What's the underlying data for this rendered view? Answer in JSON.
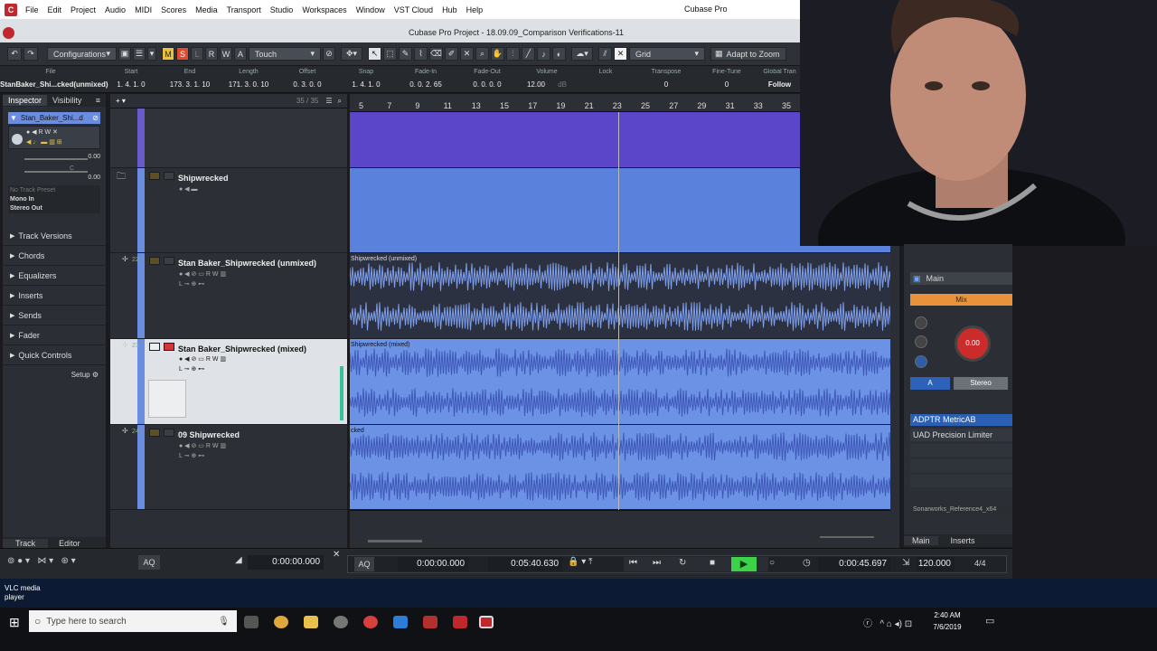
{
  "menubar": {
    "items": [
      "File",
      "Edit",
      "Project",
      "Audio",
      "MIDI",
      "Scores",
      "Media",
      "Transport",
      "Studio",
      "Workspaces",
      "Window",
      "VST Cloud",
      "Hub",
      "Help"
    ],
    "app_title": "Cubase Pro"
  },
  "project": {
    "title": "Cubase Pro Project - 18.09.09_Comparison Verifications-11"
  },
  "toolbar": {
    "configurations": "Configurations",
    "m": "M",
    "s": "S",
    "l": "L",
    "r": "R",
    "w": "W",
    "a": "A",
    "automation_mode": "Touch",
    "snap_type": "Grid",
    "adapt_to_zoom": "Adapt to Zoom"
  },
  "infoline": {
    "headers": [
      "File",
      "Start",
      "End",
      "Length",
      "Offset",
      "Snap",
      "Fade-In",
      "Fade-Out",
      "Volume",
      "Lock",
      "Transpose",
      "Fine-Tune",
      "Global Tran"
    ],
    "values": [
      "StanBaker_Shi...cked(unmixed)",
      "1. 4. 1.  0",
      "173. 3. 1. 10",
      "171. 3. 0. 10",
      "0. 3. 0.  0",
      "1. 4. 1.  0",
      "0. 0. 2. 65",
      "0. 0. 0.  0",
      "12.00",
      "",
      "0",
      "0",
      "Follow"
    ],
    "volume_unit": "dB"
  },
  "inspector": {
    "tabs": [
      "Inspector",
      "Visibility"
    ],
    "track_name": "Stan_Baker_Shi...d",
    "fader_value": "0.00",
    "pan_value": "C",
    "vol_value": "0.00",
    "preset": "No Track Preset",
    "input": "Mono In",
    "output": "Stereo Out",
    "sections": [
      "Track Versions",
      "Chords",
      "Equalizers",
      "Inserts",
      "Sends",
      "Fader",
      "Quick Controls"
    ],
    "setup": "Setup",
    "bottom_tabs": [
      "Track",
      "Editor"
    ]
  },
  "tracklist": {
    "count": "35 / 35",
    "tracks": [
      {
        "number": "",
        "name": "Shipwrecked"
      },
      {
        "number": "22",
        "name": "Stan Baker_Shipwrecked (unmixed)"
      },
      {
        "number": "23",
        "name": "Stan Baker_Shipwrecked (mixed)"
      },
      {
        "number": "24",
        "name": "09 Shipwrecked"
      }
    ]
  },
  "ruler": {
    "bars": [
      "5",
      "7",
      "9",
      "11",
      "13",
      "15",
      "17",
      "19",
      "21",
      "23",
      "25",
      "27",
      "29",
      "31",
      "33",
      "35"
    ]
  },
  "events": {
    "labels": [
      "Shipwrecked (unmixed)",
      "Shipwrecked (mixed)",
      "cked"
    ]
  },
  "mixpanel": {
    "channel": "Main",
    "mix": "Mix",
    "gain": "0.00",
    "a": "A",
    "stereo": "Stereo",
    "inserts": [
      "ADPTR MetricAB",
      "UAD Precision Limiter"
    ],
    "plugin": "Sonarworks_Reference4_x64",
    "tabs": [
      "Main",
      "Inserts"
    ]
  },
  "transport": {
    "aq": "AQ",
    "left_time": "0:00:00.000",
    "pos1": "0:00:00.000",
    "pos2": "0:05:40.630",
    "main_time": "0:00:45.697",
    "tempo": "120.000",
    "signature": "4/4"
  },
  "desktop": {
    "vlc_label": "VLC media player"
  },
  "taskbar": {
    "search_placeholder": "Type here to search",
    "time": "2:40 AM",
    "date": "7/6/2019"
  },
  "colors": {
    "track_blue": "#6a8de0",
    "event_purple": "#5b45c8",
    "event_blue": "#5a82dc",
    "wave_dark": "#3f58b8",
    "accent_red": "#c0282d"
  }
}
